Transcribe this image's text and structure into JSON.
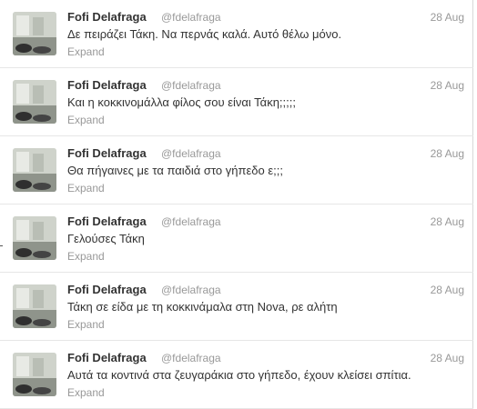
{
  "tweets": [
    {
      "name": "Fofi Delafraga",
      "handle": "@fdelafraga",
      "time": "28 Aug",
      "text": "Δε πειράζει Τάκη. Να περνάς καλά. Αυτό θέλω μόνο.",
      "expand": "Expand"
    },
    {
      "name": "Fofi Delafraga",
      "handle": "@fdelafraga",
      "time": "28 Aug",
      "text": "Και η κοκκινομάλλα φίλος σου είναι Τάκη;;;;;",
      "expand": "Expand"
    },
    {
      "name": "Fofi Delafraga",
      "handle": "@fdelafraga",
      "time": "28 Aug",
      "text": "Θα πήγαινες με τα παιδιά στο γήπεδο ε;;;",
      "expand": "Expand"
    },
    {
      "name": "Fofi Delafraga",
      "handle": "@fdelafraga",
      "time": "28 Aug",
      "text": "Γελούσες Τάκη",
      "expand": "Expand"
    },
    {
      "name": "Fofi Delafraga",
      "handle": "@fdelafraga",
      "time": "28 Aug",
      "text": "Τάκη σε είδα με τη κοκκινάμαλα στη Nova, ρε αλήτη",
      "expand": "Expand"
    },
    {
      "name": "Fofi Delafraga",
      "handle": "@fdelafraga",
      "time": "28 Aug",
      "text": "Αυτά τα κοντινά στα ζευγαράκια στο γήπεδο, έχουν κλείσει σπίτια.",
      "expand": "Expand"
    }
  ],
  "colors": {
    "name": "#333333",
    "meta": "#999999",
    "divider": "#e6e6e6"
  }
}
